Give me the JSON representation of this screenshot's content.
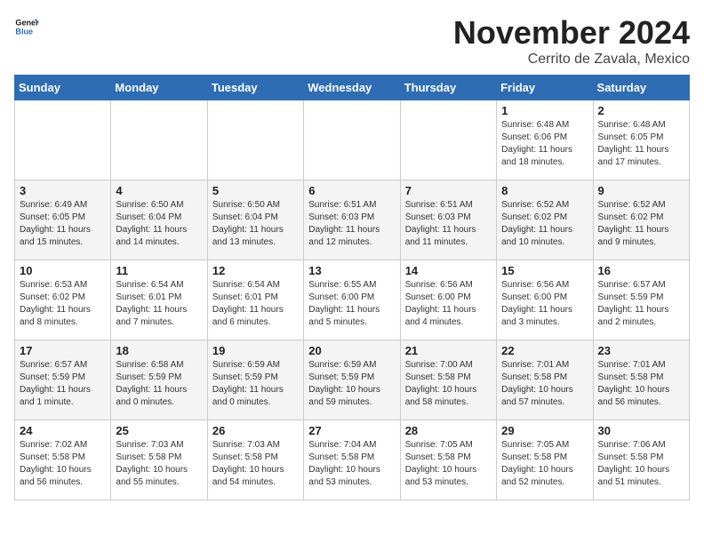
{
  "logo": {
    "line1": "General",
    "line2": "Blue"
  },
  "title": "November 2024",
  "location": "Cerrito de Zavala, Mexico",
  "days_of_week": [
    "Sunday",
    "Monday",
    "Tuesday",
    "Wednesday",
    "Thursday",
    "Friday",
    "Saturday"
  ],
  "weeks": [
    [
      {
        "day": "",
        "detail": ""
      },
      {
        "day": "",
        "detail": ""
      },
      {
        "day": "",
        "detail": ""
      },
      {
        "day": "",
        "detail": ""
      },
      {
        "day": "",
        "detail": ""
      },
      {
        "day": "1",
        "detail": "Sunrise: 6:48 AM\nSunset: 6:06 PM\nDaylight: 11 hours\nand 18 minutes."
      },
      {
        "day": "2",
        "detail": "Sunrise: 6:48 AM\nSunset: 6:05 PM\nDaylight: 11 hours\nand 17 minutes."
      }
    ],
    [
      {
        "day": "3",
        "detail": "Sunrise: 6:49 AM\nSunset: 6:05 PM\nDaylight: 11 hours\nand 15 minutes."
      },
      {
        "day": "4",
        "detail": "Sunrise: 6:50 AM\nSunset: 6:04 PM\nDaylight: 11 hours\nand 14 minutes."
      },
      {
        "day": "5",
        "detail": "Sunrise: 6:50 AM\nSunset: 6:04 PM\nDaylight: 11 hours\nand 13 minutes."
      },
      {
        "day": "6",
        "detail": "Sunrise: 6:51 AM\nSunset: 6:03 PM\nDaylight: 11 hours\nand 12 minutes."
      },
      {
        "day": "7",
        "detail": "Sunrise: 6:51 AM\nSunset: 6:03 PM\nDaylight: 11 hours\nand 11 minutes."
      },
      {
        "day": "8",
        "detail": "Sunrise: 6:52 AM\nSunset: 6:02 PM\nDaylight: 11 hours\nand 10 minutes."
      },
      {
        "day": "9",
        "detail": "Sunrise: 6:52 AM\nSunset: 6:02 PM\nDaylight: 11 hours\nand 9 minutes."
      }
    ],
    [
      {
        "day": "10",
        "detail": "Sunrise: 6:53 AM\nSunset: 6:02 PM\nDaylight: 11 hours\nand 8 minutes."
      },
      {
        "day": "11",
        "detail": "Sunrise: 6:54 AM\nSunset: 6:01 PM\nDaylight: 11 hours\nand 7 minutes."
      },
      {
        "day": "12",
        "detail": "Sunrise: 6:54 AM\nSunset: 6:01 PM\nDaylight: 11 hours\nand 6 minutes."
      },
      {
        "day": "13",
        "detail": "Sunrise: 6:55 AM\nSunset: 6:00 PM\nDaylight: 11 hours\nand 5 minutes."
      },
      {
        "day": "14",
        "detail": "Sunrise: 6:56 AM\nSunset: 6:00 PM\nDaylight: 11 hours\nand 4 minutes."
      },
      {
        "day": "15",
        "detail": "Sunrise: 6:56 AM\nSunset: 6:00 PM\nDaylight: 11 hours\nand 3 minutes."
      },
      {
        "day": "16",
        "detail": "Sunrise: 6:57 AM\nSunset: 5:59 PM\nDaylight: 11 hours\nand 2 minutes."
      }
    ],
    [
      {
        "day": "17",
        "detail": "Sunrise: 6:57 AM\nSunset: 5:59 PM\nDaylight: 11 hours\nand 1 minute."
      },
      {
        "day": "18",
        "detail": "Sunrise: 6:58 AM\nSunset: 5:59 PM\nDaylight: 11 hours\nand 0 minutes."
      },
      {
        "day": "19",
        "detail": "Sunrise: 6:59 AM\nSunset: 5:59 PM\nDaylight: 11 hours\nand 0 minutes."
      },
      {
        "day": "20",
        "detail": "Sunrise: 6:59 AM\nSunset: 5:59 PM\nDaylight: 10 hours\nand 59 minutes."
      },
      {
        "day": "21",
        "detail": "Sunrise: 7:00 AM\nSunset: 5:58 PM\nDaylight: 10 hours\nand 58 minutes."
      },
      {
        "day": "22",
        "detail": "Sunrise: 7:01 AM\nSunset: 5:58 PM\nDaylight: 10 hours\nand 57 minutes."
      },
      {
        "day": "23",
        "detail": "Sunrise: 7:01 AM\nSunset: 5:58 PM\nDaylight: 10 hours\nand 56 minutes."
      }
    ],
    [
      {
        "day": "24",
        "detail": "Sunrise: 7:02 AM\nSunset: 5:58 PM\nDaylight: 10 hours\nand 56 minutes."
      },
      {
        "day": "25",
        "detail": "Sunrise: 7:03 AM\nSunset: 5:58 PM\nDaylight: 10 hours\nand 55 minutes."
      },
      {
        "day": "26",
        "detail": "Sunrise: 7:03 AM\nSunset: 5:58 PM\nDaylight: 10 hours\nand 54 minutes."
      },
      {
        "day": "27",
        "detail": "Sunrise: 7:04 AM\nSunset: 5:58 PM\nDaylight: 10 hours\nand 53 minutes."
      },
      {
        "day": "28",
        "detail": "Sunrise: 7:05 AM\nSunset: 5:58 PM\nDaylight: 10 hours\nand 53 minutes."
      },
      {
        "day": "29",
        "detail": "Sunrise: 7:05 AM\nSunset: 5:58 PM\nDaylight: 10 hours\nand 52 minutes."
      },
      {
        "day": "30",
        "detail": "Sunrise: 7:06 AM\nSunset: 5:58 PM\nDaylight: 10 hours\nand 51 minutes."
      }
    ]
  ]
}
